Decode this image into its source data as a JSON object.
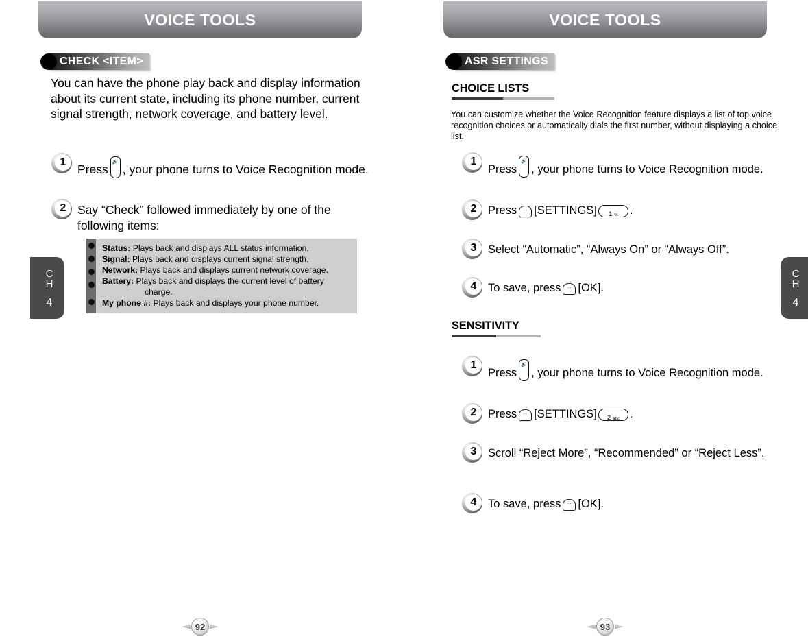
{
  "document": {
    "banner_title": "VOICE TOOLS"
  },
  "left_page": {
    "banner_title": "VOICE TOOLS",
    "badge_label": "CHECK <ITEM>",
    "intro": "You can have the phone play back and display information about its current state, including its phone number, current signal strength, network coverage, and battery level.",
    "steps": [
      {
        "number": "1",
        "text_before": "Press",
        "key": "side-voice-key",
        "text_after": ", your phone turns to Voice Recognition mode."
      },
      {
        "number": "2",
        "text_before": "Say “Check” followed immediately by one of the following items:",
        "key": "",
        "text_after": ""
      }
    ],
    "info_box": {
      "items": [
        {
          "term": "Status:",
          "desc": "Plays back and displays ALL status information."
        },
        {
          "term": "Signal:",
          "desc": "Plays back and displays current signal strength."
        },
        {
          "term": "Network:",
          "desc": "Plays back and displays current network coverage."
        },
        {
          "term": "Battery:",
          "desc": "Plays back and displays the current level of battery"
        },
        {
          "term": "My phone #:",
          "desc": "Plays back and displays your phone number."
        }
      ],
      "continuation": "charge."
    },
    "chapter_tab": {
      "line1": "C",
      "line2": "H",
      "number": "4"
    },
    "page_number": "92"
  },
  "right_page": {
    "banner_title": "VOICE TOOLS",
    "badge_label": "ASR SETTINGS",
    "sections": [
      {
        "heading": "CHOICE LISTS",
        "intro": "You can customize whether the Voice Recognition feature displays a list of top voice recognition choices or automatically dials the first number, without displaying a choice list.",
        "steps": [
          {
            "number": "1",
            "pre": "Press",
            "key": "side-voice-key",
            "post": ", your phone turns to Voice Recognition mode.",
            "key2": "",
            "tail": ""
          },
          {
            "number": "2",
            "pre": "Press",
            "key": "soft-key",
            "post": "[SETTINGS]",
            "key2": "num-key-1",
            "key2_digit": "1",
            "key2_sub": "℅",
            "tail": "."
          },
          {
            "number": "3",
            "pre": "Select “Automatic”, “Always On” or “Always Off”.",
            "key": "",
            "post": "",
            "key2": "",
            "tail": ""
          },
          {
            "number": "4",
            "pre": "To save, press",
            "key": "soft-key",
            "post": "[OK].",
            "key2": "",
            "tail": ""
          }
        ]
      },
      {
        "heading": "SENSITIVITY",
        "intro": "",
        "steps": [
          {
            "number": "1",
            "pre": "Press",
            "key": "side-voice-key",
            "post": ", your phone turns to Voice Recognition mode.",
            "key2": "",
            "tail": ""
          },
          {
            "number": "2",
            "pre": "Press",
            "key": "soft-key",
            "post": "[SETTINGS]",
            "key2": "num-key-2",
            "key2_digit": "2",
            "key2_sub": "abc",
            "tail": "."
          },
          {
            "number": "3",
            "pre": "Scroll “Reject More”, “Recommended” or “Reject Less”.",
            "key": "",
            "post": "",
            "key2": "",
            "tail": ""
          },
          {
            "number": "4",
            "pre": "To save, press",
            "key": "soft-key",
            "post": "[OK].",
            "key2": "",
            "tail": ""
          }
        ]
      }
    ],
    "chapter_tab": {
      "line1": "C",
      "line2": "H",
      "number": "4"
    },
    "page_number": "93"
  },
  "colors": {
    "banner_top": "#b7b9bc",
    "banner_bottom": "#6a6c70",
    "badge_dark": "#1c1c1c",
    "badge_light": "#bdbdbd",
    "infobox_bg": "#cfcfcf",
    "infobox_rail": "#6d6d6d",
    "chapter_tab": "#4a4a4a",
    "rule_dark": "#3a3a3a",
    "rule_light": "#b3b3b3"
  }
}
